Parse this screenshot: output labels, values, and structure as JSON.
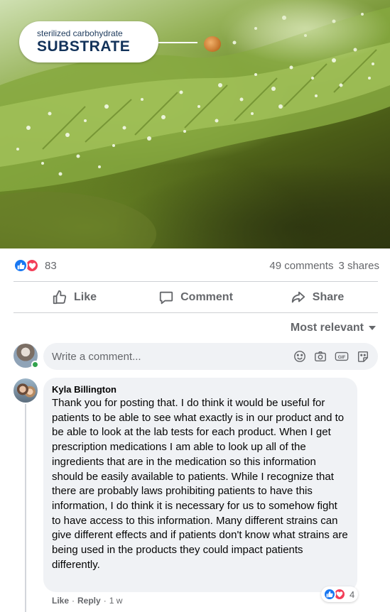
{
  "post_image": {
    "label_small": "sterilized carbohydrate",
    "label_big": "SUBSTRATE"
  },
  "reactions": {
    "count": "83",
    "comments": "49 comments",
    "shares": "3 shares",
    "types": [
      "like-icon",
      "love-icon"
    ]
  },
  "actions": {
    "like": "Like",
    "comment": "Comment",
    "share": "Share"
  },
  "sort": {
    "label": "Most relevant"
  },
  "compose": {
    "placeholder": "Write a comment..."
  },
  "comment": {
    "author": "Kyla Billington",
    "text": "Thank you for posting that. I do think it would be useful for patients to be able to see what exactly is in our product and to be able to look at the lab tests for each product. When I get prescription medications I am able to look up all of the ingredients that are in the medication so this information should be easily available to patients. While I recognize that there are probably laws prohibiting patients to have this information, I do think it is necessary for us to somehow fight to have access to this information. Many different strains can give different effects and if patients don't know what strains are being used in the products they could impact patients differently.",
    "reaction_count": "4",
    "like_label": "Like",
    "separator": "·",
    "reply_label": "Reply",
    "time": "1 w"
  },
  "colors": {
    "like_blue": "#1877f2",
    "love_red": "#f33e58",
    "online_green": "#31a24c",
    "meta_gray": "#65676b"
  }
}
